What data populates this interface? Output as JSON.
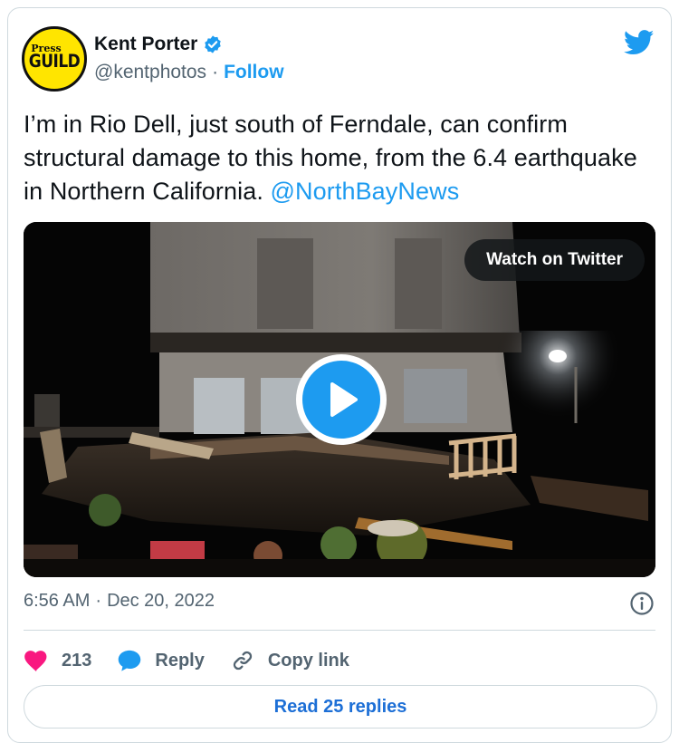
{
  "author": {
    "display_name": "Kent Porter",
    "handle": "@kentphotos",
    "separator": "·",
    "follow_label": "Follow",
    "avatar": {
      "top_text": "Press",
      "main_text": "GUILD",
      "bg_color": "#ffe500"
    },
    "verified": true
  },
  "tweet": {
    "text": "I’m in Rio Dell, just south of Ferndale, can confirm structural damage to this home, from the 6.4 earthquake in Northern California.",
    "mention": "@NorthBayNews"
  },
  "media": {
    "watch_label": "Watch on Twitter",
    "play_icon": "play-icon"
  },
  "meta": {
    "time": "6:56 AM",
    "separator": "·",
    "date": "Dec 20, 2022"
  },
  "actions": {
    "like_count": "213",
    "reply_label": "Reply",
    "copy_link_label": "Copy link"
  },
  "read_replies_label": "Read 25 replies",
  "colors": {
    "accent": "#1d9bf0",
    "like": "#f91880",
    "text_secondary": "#536471",
    "border": "#cfd9de"
  }
}
